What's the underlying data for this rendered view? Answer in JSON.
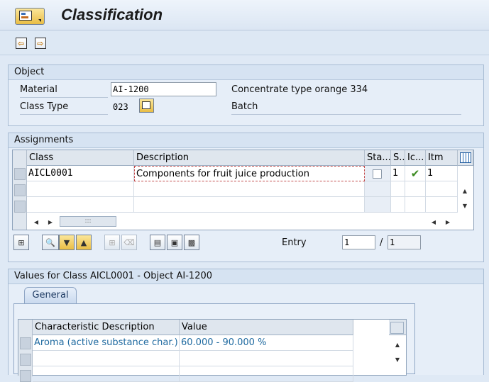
{
  "window": {
    "title": "Classification"
  },
  "toolbar": {
    "icons": [
      "previous-icon",
      "next-icon"
    ]
  },
  "object": {
    "section_title": "Object",
    "material_label": "Material",
    "material_value": "AI-1200",
    "material_desc": "Concentrate type orange 334",
    "class_type_label": "Class Type",
    "class_type_value": "023",
    "class_type_desc": "Batch"
  },
  "assignments": {
    "section_title": "Assignments",
    "columns": [
      "Class",
      "Description",
      "Sta...",
      "S..",
      "Ic...",
      "Itm"
    ],
    "rows": [
      {
        "class": "AICL0001",
        "description": "Components for fruit juice production",
        "status_checked": false,
        "s": "1",
        "icon": "checkmark-icon",
        "itm": "1"
      }
    ],
    "entry_label": "Entry",
    "entry_value": "1",
    "entry_separator": "/",
    "entry_total": "1"
  },
  "values": {
    "section_title": "Values for Class AICL0001 - Object AI-1200",
    "tab_label": "General",
    "columns": [
      "Characteristic Description",
      "Value"
    ],
    "rows": [
      {
        "characteristic": "Aroma (active substance char.)",
        "value": "60.000 - 90.000 %"
      }
    ]
  },
  "colors": {
    "accent": "#1f6aa0",
    "button_yellow": "#f3d36c",
    "background": "#dfe9f5"
  }
}
